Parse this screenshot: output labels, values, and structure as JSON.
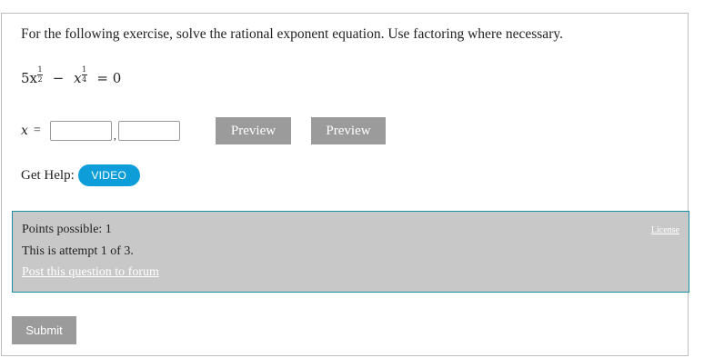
{
  "question": {
    "prompt": "For the following exercise, solve the rational exponent equation. Use factoring where necessary.",
    "equation": {
      "coef": "5x",
      "exp1_num": "1",
      "exp1_den": "2",
      "minus": "−",
      "var2": "x",
      "exp2_num": "1",
      "exp2_den": "4",
      "rhs": "= 0"
    },
    "answer": {
      "var": "x",
      "equals": "=",
      "separator": ",",
      "field1_value": "",
      "field2_value": ""
    },
    "preview1_label": "Preview",
    "preview2_label": "Preview",
    "help_label": "Get Help:",
    "video_label": "VIDEO"
  },
  "info": {
    "points": "Points possible: 1",
    "attempt": "This is attempt 1 of 3.",
    "forum_link": "Post this question to forum",
    "license_link": "License"
  },
  "submit_label": "Submit",
  "colors": {
    "button_grey": "#9b9b9b",
    "video_blue": "#0d9ed9",
    "info_bg": "#c8c8c8",
    "info_border": "#1a8fa0"
  }
}
